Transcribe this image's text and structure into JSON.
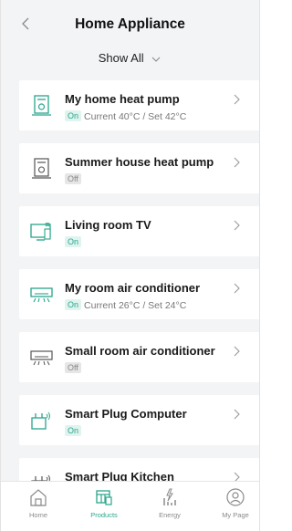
{
  "header": {
    "title": "Home Appliance",
    "filter_label": "Show All"
  },
  "devices": [
    {
      "name": "My home heat pump",
      "status": "On",
      "detail": "Current 40°C / Set 42°C",
      "icon": "heat-pump-icon"
    },
    {
      "name": "Summer house heat pump",
      "status": "Off",
      "detail": "",
      "icon": "heat-pump-icon"
    },
    {
      "name": "Living room TV",
      "status": "On",
      "detail": "",
      "icon": "tv-icon"
    },
    {
      "name": "My room air conditioner",
      "status": "On",
      "detail": "Current 26°C / Set 24°C",
      "icon": "air-conditioner-icon"
    },
    {
      "name": "Small room air conditioner",
      "status": "Off",
      "detail": "",
      "icon": "air-conditioner-icon"
    },
    {
      "name": "Smart Plug Computer",
      "status": "On",
      "detail": "",
      "icon": "smart-plug-icon"
    },
    {
      "name": "Smart Plug Kitchen",
      "status": "",
      "detail": "",
      "icon": "smart-plug-icon"
    }
  ],
  "tabbar": {
    "tabs": [
      {
        "label": "Home",
        "icon": "home-icon"
      },
      {
        "label": "Products",
        "icon": "products-icon"
      },
      {
        "label": "Energy",
        "icon": "energy-icon"
      },
      {
        "label": "My Page",
        "icon": "user-icon"
      }
    ],
    "active": "Products"
  },
  "colors": {
    "accent": "#2aa58c",
    "background": "#f3f4f6",
    "on_badge_bg": "#dff4ef",
    "off_badge_bg": "#e6e6e6"
  }
}
